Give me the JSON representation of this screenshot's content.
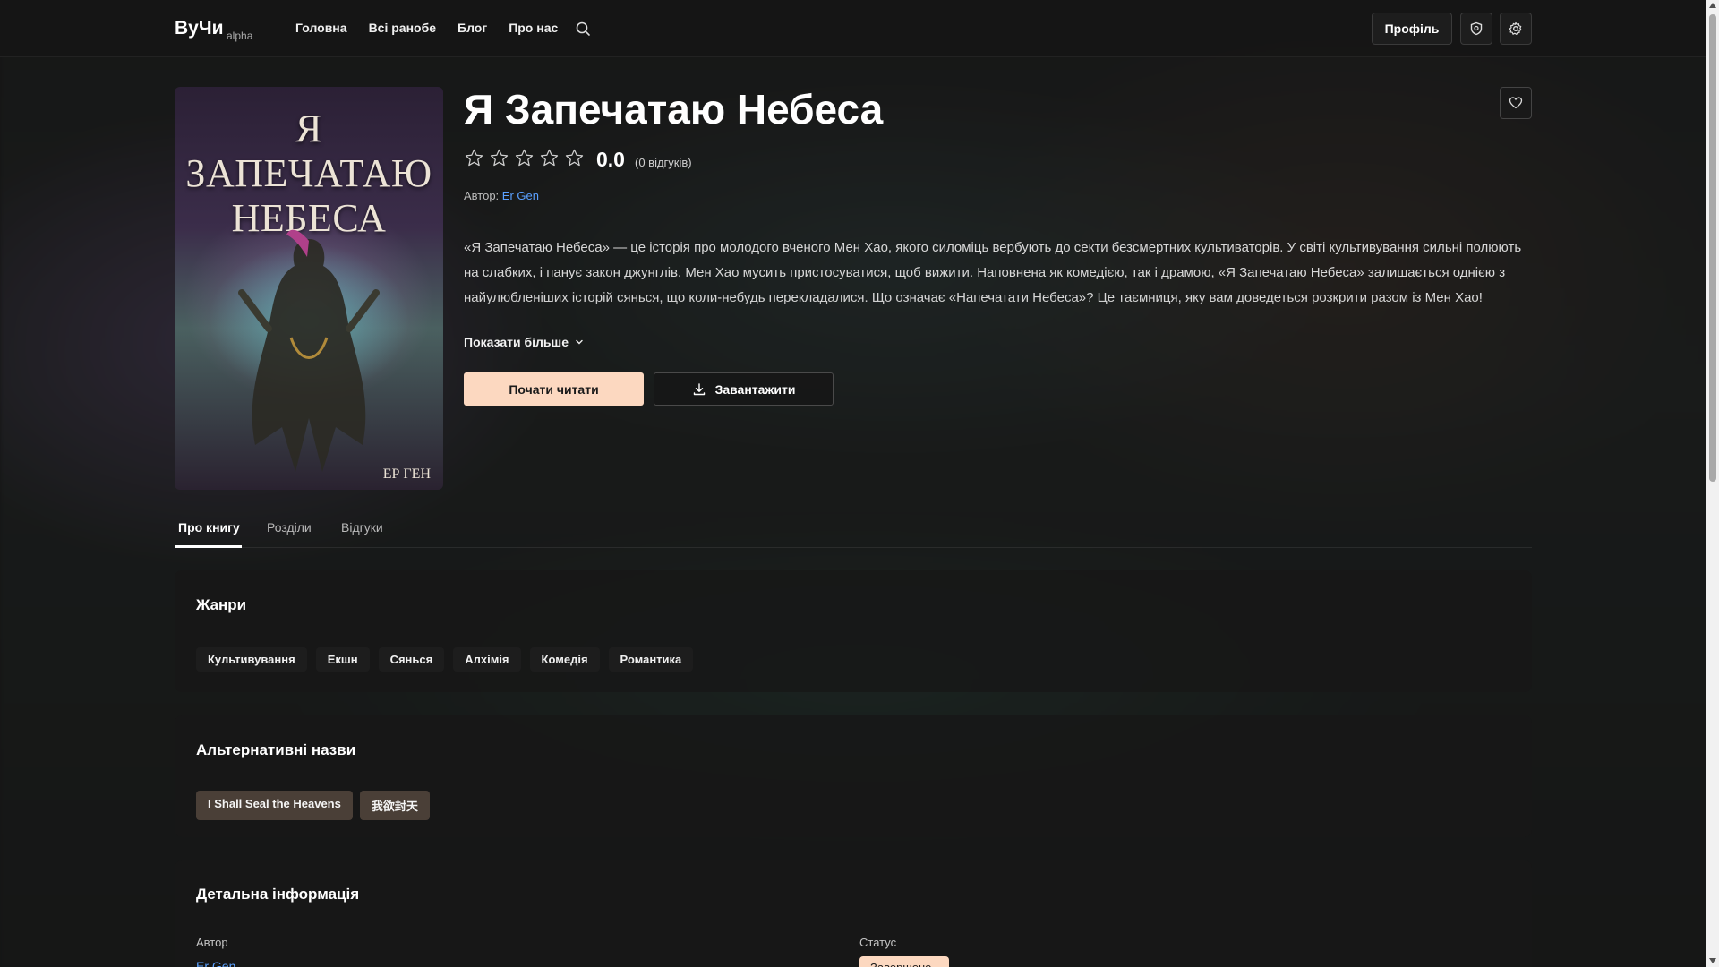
{
  "header": {
    "logo": "ВуЧи",
    "logo_sub": "alpha",
    "nav": [
      "Головна",
      "Всі ранобе",
      "Блог",
      "Про нас"
    ],
    "profile_label": "Профіль"
  },
  "book": {
    "title": "Я Запечатаю Небеса",
    "cover_title": "Я ЗАПЕЧАТАЮ НЕБЕСА",
    "cover_author": "ЕР ГЕН",
    "rating": "0.0",
    "rating_count": "(0 відгуків)",
    "stars_filled": 0,
    "stars_total": 5,
    "author_label": "Автор:",
    "author": "Er Gen",
    "description": "«Я Запечатаю Небеса» — це історія про молодого вченого Мен Хао, якого силоміць вербують до секти безсмертних культиваторів. У світі культивування сильні полюють на слабких, і панує закон джунглів. Мен Хао мусить пристосуватися, щоб вижити. Наповнена як комедією, так і драмою, «Я Запечатаю Небеса» залишається однією з найулюбленіших історій сянься, що коли-небудь перекладалися. Що означає «Напечатати Небеса»? Це таємниця, яку вам доведеться розкрити разом із Мен Хао!",
    "show_more": "Показати більше",
    "read_button": "Почати читати",
    "download_button": "Завантажити"
  },
  "tabs": [
    {
      "label": "Про книгу",
      "active": true
    },
    {
      "label": "Розділи",
      "active": false
    },
    {
      "label": "Відгуки",
      "active": false
    }
  ],
  "genres": {
    "title": "Жанри",
    "items": [
      "Культивування",
      "Екшн",
      "Сянься",
      "Алхімія",
      "Комедія",
      "Романтика"
    ]
  },
  "alt_names": {
    "title": "Альтернативні назви",
    "items": [
      "I Shall Seal the Heavens",
      "我欲封天"
    ]
  },
  "details": {
    "title": "Детальна інформація",
    "author_label": "Автор",
    "author_value": "Er Gen",
    "status_label": "Статус",
    "status_value": "Завершено"
  },
  "colors": {
    "accent": "#fcd8c0",
    "link": "#5aa0ff",
    "alt_tag": "#4a3f37"
  }
}
